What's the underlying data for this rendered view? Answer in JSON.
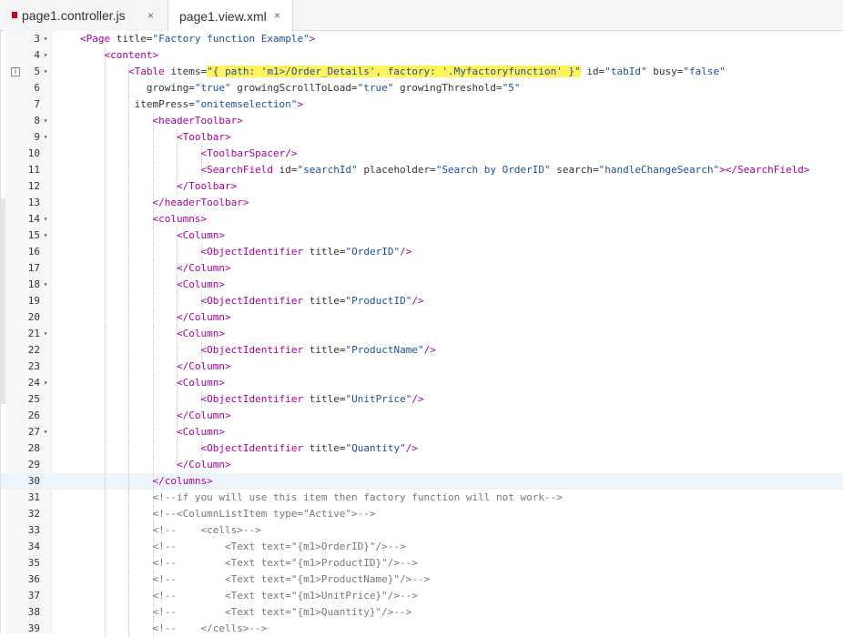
{
  "tabs": [
    {
      "label": "page1.controller.js",
      "close": "×",
      "active": false
    },
    {
      "label": "page1.view.xml",
      "close": "×",
      "active": true
    }
  ],
  "editor": {
    "current_line": "30",
    "info_icon_line": "5",
    "colors": {
      "tag": "#a4009c",
      "value": "#1f4e9a",
      "comment": "#777777",
      "highlight": "#fff45c"
    },
    "lines": [
      {
        "num": "3",
        "fold": true,
        "indent": 1,
        "tokens": [
          [
            "tag",
            "<Page "
          ],
          [
            "attr",
            "title="
          ],
          [
            "val",
            "\"Factory function Example\""
          ],
          [
            "tag",
            ">"
          ]
        ]
      },
      {
        "num": "4",
        "fold": true,
        "indent": 2,
        "tokens": [
          [
            "tag",
            "<content>"
          ]
        ]
      },
      {
        "num": "5",
        "fold": true,
        "indent": 3,
        "tokens": [
          [
            "tag",
            "<Table "
          ],
          [
            "attr",
            "items="
          ],
          [
            "hl",
            "\"{ path: 'm1>/Order_Details', factory: '.Myfactoryfunction' }\""
          ],
          [
            "text",
            " "
          ],
          [
            "attr",
            "id="
          ],
          [
            "val",
            "\"tabId\""
          ],
          [
            "text",
            " "
          ],
          [
            "attr",
            "busy="
          ],
          [
            "val",
            "\"false\""
          ]
        ]
      },
      {
        "num": "6",
        "fold": false,
        "indent": 3,
        "pad": 3,
        "tokens": [
          [
            "attr",
            "growing="
          ],
          [
            "val",
            "\"true\""
          ],
          [
            "text",
            " "
          ],
          [
            "attr",
            "growingScrollToLoad="
          ],
          [
            "val",
            "\"true\""
          ],
          [
            "text",
            " "
          ],
          [
            "attr",
            "growingThreshold="
          ],
          [
            "val",
            "\"5\""
          ]
        ]
      },
      {
        "num": "7",
        "fold": false,
        "indent": 3,
        "pad": 1,
        "tokens": [
          [
            "attr",
            "itemPress="
          ],
          [
            "val",
            "\"onitemselection\""
          ],
          [
            "tag",
            ">"
          ]
        ]
      },
      {
        "num": "8",
        "fold": true,
        "indent": 4,
        "tokens": [
          [
            "tag",
            "<headerToolbar>"
          ]
        ]
      },
      {
        "num": "9",
        "fold": true,
        "indent": 5,
        "tokens": [
          [
            "tag",
            "<Toolbar>"
          ]
        ]
      },
      {
        "num": "10",
        "fold": false,
        "indent": 6,
        "tokens": [
          [
            "tag",
            "<ToolbarSpacer/>"
          ]
        ]
      },
      {
        "num": "11",
        "fold": false,
        "indent": 6,
        "tokens": [
          [
            "tag",
            "<SearchField "
          ],
          [
            "attr",
            "id="
          ],
          [
            "val",
            "\"searchId\""
          ],
          [
            "text",
            " "
          ],
          [
            "attr",
            "placeholder="
          ],
          [
            "val",
            "\"Search by OrderID\""
          ],
          [
            "text",
            " "
          ],
          [
            "attr",
            "search="
          ],
          [
            "val",
            "\"handleChangeSearch\""
          ],
          [
            "tag",
            "></SearchField>"
          ]
        ]
      },
      {
        "num": "12",
        "fold": false,
        "indent": 5,
        "tokens": [
          [
            "tag",
            "</Toolbar>"
          ]
        ]
      },
      {
        "num": "13",
        "fold": false,
        "indent": 4,
        "tokens": [
          [
            "tag",
            "</headerToolbar>"
          ]
        ]
      },
      {
        "num": "14",
        "fold": true,
        "indent": 4,
        "tokens": [
          [
            "tag",
            "<columns>"
          ]
        ]
      },
      {
        "num": "15",
        "fold": true,
        "indent": 5,
        "tokens": [
          [
            "tag",
            "<Column>"
          ]
        ]
      },
      {
        "num": "16",
        "fold": false,
        "indent": 6,
        "tokens": [
          [
            "tag",
            "<ObjectIdentifier "
          ],
          [
            "attr",
            "title="
          ],
          [
            "val",
            "\"OrderID\""
          ],
          [
            "tag",
            "/>"
          ]
        ]
      },
      {
        "num": "17",
        "fold": false,
        "indent": 5,
        "tokens": [
          [
            "tag",
            "</Column>"
          ]
        ]
      },
      {
        "num": "18",
        "fold": true,
        "indent": 5,
        "tokens": [
          [
            "tag",
            "<Column>"
          ]
        ]
      },
      {
        "num": "19",
        "fold": false,
        "indent": 6,
        "tokens": [
          [
            "tag",
            "<ObjectIdentifier "
          ],
          [
            "attr",
            "title="
          ],
          [
            "val",
            "\"ProductID\""
          ],
          [
            "tag",
            "/>"
          ]
        ]
      },
      {
        "num": "20",
        "fold": false,
        "indent": 5,
        "tokens": [
          [
            "tag",
            "</Column>"
          ]
        ]
      },
      {
        "num": "21",
        "fold": true,
        "indent": 5,
        "tokens": [
          [
            "tag",
            "<Column>"
          ]
        ]
      },
      {
        "num": "22",
        "fold": false,
        "indent": 6,
        "tokens": [
          [
            "tag",
            "<ObjectIdentifier "
          ],
          [
            "attr",
            "title="
          ],
          [
            "val",
            "\"ProductName\""
          ],
          [
            "tag",
            "/>"
          ]
        ]
      },
      {
        "num": "23",
        "fold": false,
        "indent": 5,
        "tokens": [
          [
            "tag",
            "</Column>"
          ]
        ]
      },
      {
        "num": "24",
        "fold": true,
        "indent": 5,
        "tokens": [
          [
            "tag",
            "<Column>"
          ]
        ]
      },
      {
        "num": "25",
        "fold": false,
        "indent": 6,
        "tokens": [
          [
            "tag",
            "<ObjectIdentifier "
          ],
          [
            "attr",
            "title="
          ],
          [
            "val",
            "\"UnitPrice\""
          ],
          [
            "tag",
            "/>"
          ]
        ]
      },
      {
        "num": "26",
        "fold": false,
        "indent": 5,
        "tokens": [
          [
            "tag",
            "</Column>"
          ]
        ]
      },
      {
        "num": "27",
        "fold": true,
        "indent": 5,
        "tokens": [
          [
            "tag",
            "<Column>"
          ]
        ]
      },
      {
        "num": "28",
        "fold": false,
        "indent": 6,
        "tokens": [
          [
            "tag",
            "<ObjectIdentifier "
          ],
          [
            "attr",
            "title="
          ],
          [
            "val",
            "\"Quantity\""
          ],
          [
            "tag",
            "/>"
          ]
        ]
      },
      {
        "num": "29",
        "fold": false,
        "indent": 5,
        "tokens": [
          [
            "tag",
            "</Column>"
          ]
        ]
      },
      {
        "num": "30",
        "fold": false,
        "indent": 4,
        "tokens": [
          [
            "tag",
            "</columns>"
          ]
        ]
      },
      {
        "num": "31",
        "fold": false,
        "indent": 4,
        "tokens": [
          [
            "cmt",
            "<!--if you will use this item then factory function will not work-->"
          ]
        ]
      },
      {
        "num": "32",
        "fold": false,
        "indent": 4,
        "tokens": [
          [
            "cmt",
            "<!--<ColumnListItem type=\"Active\">-->"
          ]
        ]
      },
      {
        "num": "33",
        "fold": false,
        "indent": 4,
        "tokens": [
          [
            "cmt",
            "<!--    <cells>-->"
          ]
        ]
      },
      {
        "num": "34",
        "fold": false,
        "indent": 4,
        "tokens": [
          [
            "cmt",
            "<!--        <Text text=\"{m1>OrderID}\"/>-->"
          ]
        ]
      },
      {
        "num": "35",
        "fold": false,
        "indent": 4,
        "tokens": [
          [
            "cmt",
            "<!--        <Text text=\"{m1>ProductID}\"/>-->"
          ]
        ]
      },
      {
        "num": "36",
        "fold": false,
        "indent": 4,
        "tokens": [
          [
            "cmt",
            "<!--        <Text text=\"{m1>ProductName}\"/>-->"
          ]
        ]
      },
      {
        "num": "37",
        "fold": false,
        "indent": 4,
        "tokens": [
          [
            "cmt",
            "<!--        <Text text=\"{m1>UnitPrice}\"/>-->"
          ]
        ]
      },
      {
        "num": "38",
        "fold": false,
        "indent": 4,
        "tokens": [
          [
            "cmt",
            "<!--        <Text text=\"{m1>Quantity}\"/>-->"
          ]
        ]
      },
      {
        "num": "39",
        "fold": false,
        "indent": 4,
        "tokens": [
          [
            "cmt",
            "<!--    </cells>-->"
          ]
        ]
      }
    ]
  }
}
